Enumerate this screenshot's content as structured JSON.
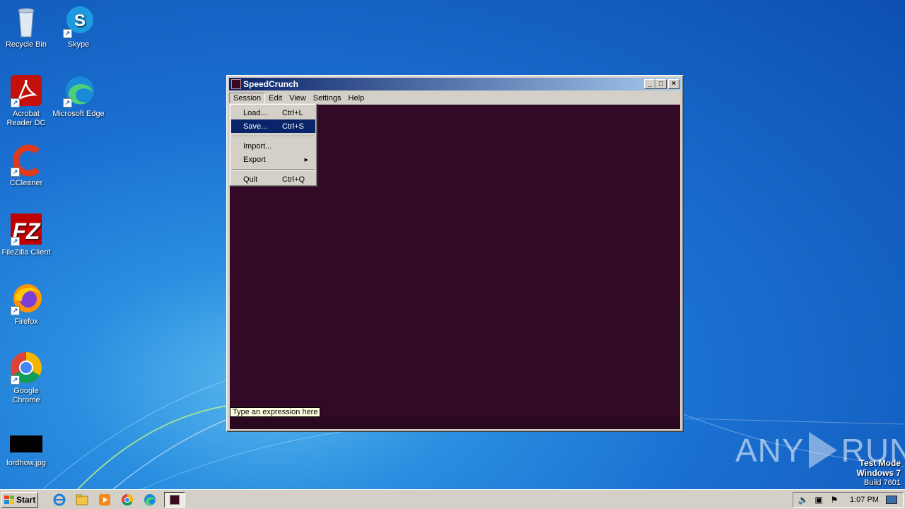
{
  "desktop": {
    "icons": [
      {
        "label": "Recycle Bin"
      },
      {
        "label": "Skype"
      },
      {
        "label": "Acrobat Reader DC"
      },
      {
        "label": "Microsoft Edge"
      },
      {
        "label": "CCleaner"
      },
      {
        "label": "FileZilla Client"
      },
      {
        "label": "Firefox"
      },
      {
        "label": "Google Chrome"
      },
      {
        "label": "lordhow.jpg"
      }
    ]
  },
  "window": {
    "title": "SpeedCrunch",
    "menu": [
      "Session",
      "Edit",
      "View",
      "Settings",
      "Help"
    ],
    "tooltip": "Type an expression here"
  },
  "dropdown": {
    "items": [
      {
        "label": "Load...",
        "shortcut": "Ctrl+L"
      },
      {
        "label": "Save...",
        "shortcut": "Ctrl+S"
      },
      {
        "label": "Import...",
        "shortcut": ""
      },
      {
        "label": "Export",
        "shortcut": ""
      },
      {
        "label": "Quit",
        "shortcut": "Ctrl+Q"
      }
    ]
  },
  "watermark": {
    "left": "ANY",
    "right": "RUN",
    "line1": "Test Mode",
    "line2": "Windows 7",
    "line3": "Build 7601"
  },
  "taskbar": {
    "start_label": "Start",
    "clock": "1:07 PM"
  }
}
